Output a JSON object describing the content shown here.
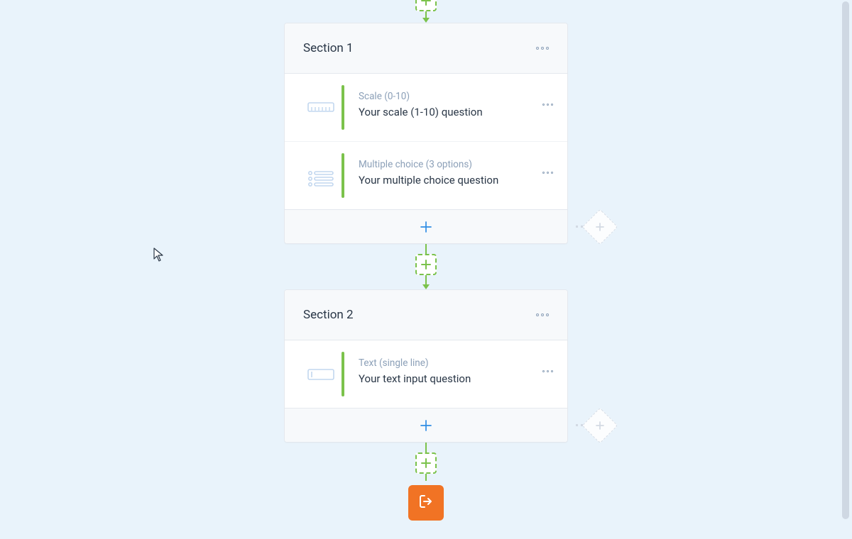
{
  "sections": [
    {
      "title": "Section 1",
      "questions": [
        {
          "type_label": "Scale (0-10)",
          "text": "Your scale (1-10) question",
          "icon": "scale"
        },
        {
          "type_label": "Multiple choice (3 options)",
          "text": "Your multiple choice question",
          "icon": "mchoice"
        }
      ]
    },
    {
      "title": "Section 2",
      "questions": [
        {
          "type_label": "Text (single line)",
          "text": "Your text input question",
          "icon": "textline"
        }
      ]
    }
  ]
}
